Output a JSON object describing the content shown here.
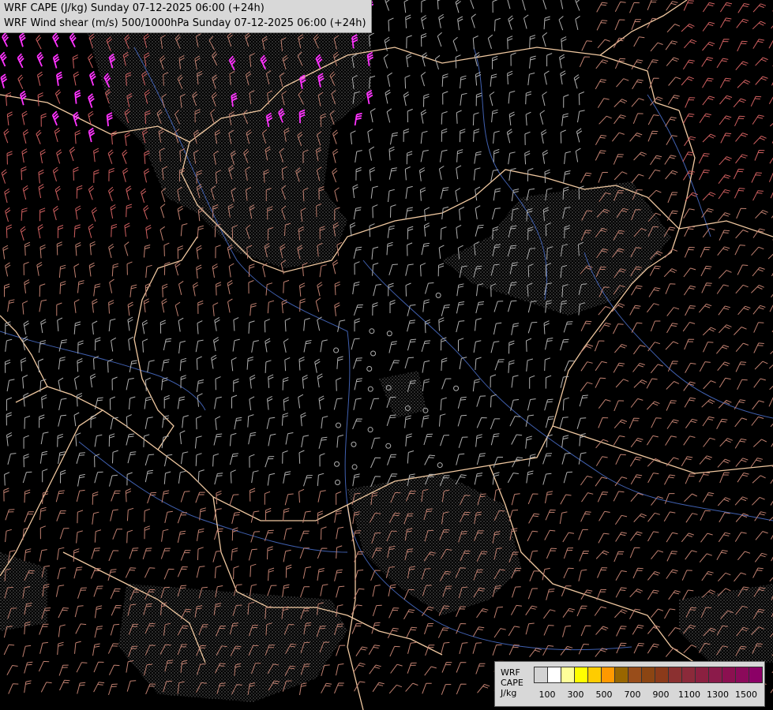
{
  "title": {
    "line1": "WRF CAPE (J/kg) Sunday 07-12-2025 06:00 (+24h)",
    "line2": "WRF Wind shear (m/s) 500/1000hPa Sunday 07-12-2025 06:00 (+24h)"
  },
  "legend": {
    "label_line1": "WRF",
    "label_line2": "CAPE",
    "label_line3": "J/kg",
    "colors": [
      "#d3d3d3",
      "#ffffff",
      "#ffff99",
      "#ffff00",
      "#ffcc00",
      "#ff9900",
      "#996600",
      "#994d1a",
      "#8b4513",
      "#8b3a1a",
      "#8b3030",
      "#8b2a3a",
      "#8b2040",
      "#8b1a4a",
      "#8b1050",
      "#8b0a5a",
      "#8b0066"
    ],
    "tick_labels": [
      "100",
      "300",
      "500",
      "700",
      "900",
      "1100",
      "1300",
      "1500"
    ]
  },
  "colors": {
    "background": "#000000",
    "border_lines": "#f0c8a0",
    "rivers": "#4060b0",
    "barb_low": "#b0b0b0",
    "barb_mid": "#c08070",
    "barb_high": "#d06060",
    "barb_max": "#ff33ff",
    "stipple": "#8a8a8a"
  }
}
